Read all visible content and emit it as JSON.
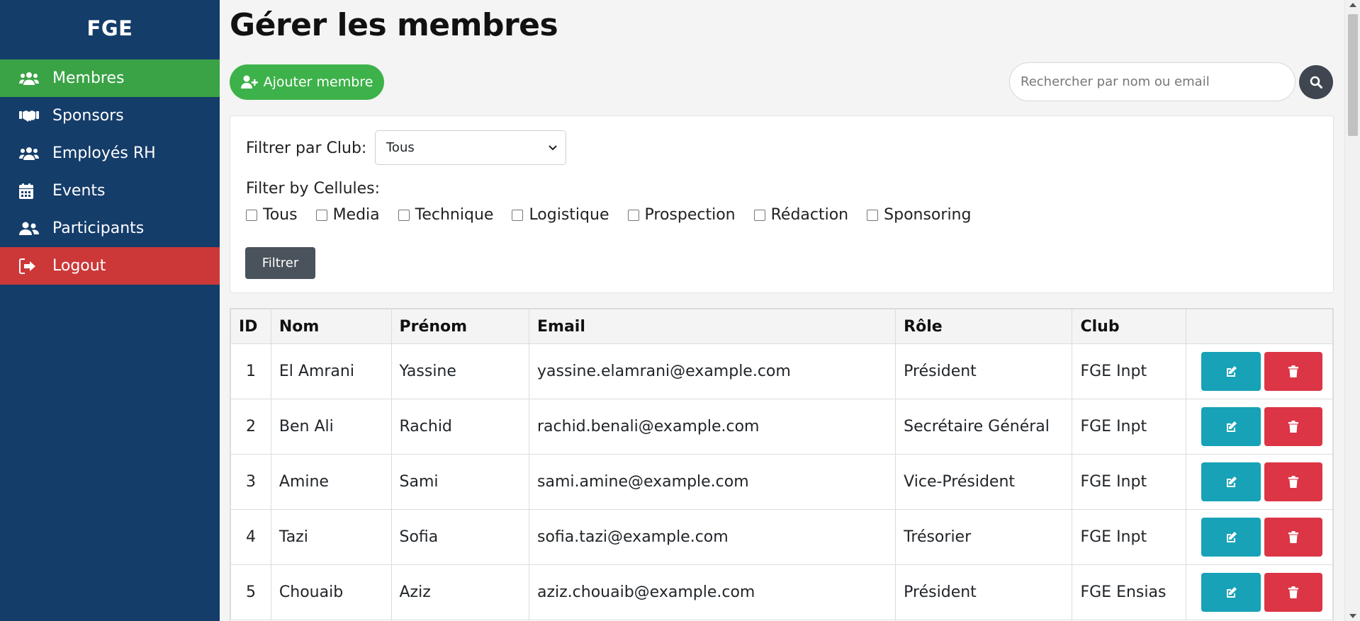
{
  "sidebar": {
    "brand": "FGE",
    "items": [
      {
        "label": "Membres",
        "icon": "users-icon",
        "active": true
      },
      {
        "label": "Sponsors",
        "icon": "handshake-icon"
      },
      {
        "label": "Employés RH",
        "icon": "users-icon"
      },
      {
        "label": "Events",
        "icon": "calendar-icon"
      },
      {
        "label": "Participants",
        "icon": "user-friends-icon"
      },
      {
        "label": "Logout",
        "icon": "sign-out-icon"
      }
    ]
  },
  "header": {
    "title": "Gérer les membres",
    "add_button": "Ajouter membre",
    "search_placeholder": "Rechercher par nom ou email"
  },
  "filters": {
    "club_label": "Filtrer par Club:",
    "club_selected": "Tous",
    "cellules_label": "Filter by Cellules:",
    "cellules": [
      "Tous",
      "Media",
      "Technique",
      "Logistique",
      "Prospection",
      "Rédaction",
      "Sponsoring"
    ],
    "filter_button": "Filtrer"
  },
  "table": {
    "headers": [
      "ID",
      "Nom",
      "Prénom",
      "Email",
      "Rôle",
      "Club",
      ""
    ],
    "rows": [
      {
        "id": "1",
        "nom": "El Amrani",
        "prenom": "Yassine",
        "email": "yassine.elamrani@example.com",
        "role": "Président",
        "club": "FGE Inpt"
      },
      {
        "id": "2",
        "nom": "Ben Ali",
        "prenom": "Rachid",
        "email": "rachid.benali@example.com",
        "role": "Secrétaire Général",
        "club": "FGE Inpt"
      },
      {
        "id": "3",
        "nom": "Amine",
        "prenom": "Sami",
        "email": "sami.amine@example.com",
        "role": "Vice-Président",
        "club": "FGE Inpt"
      },
      {
        "id": "4",
        "nom": "Tazi",
        "prenom": "Sofia",
        "email": "sofia.tazi@example.com",
        "role": "Trésorier",
        "club": "FGE Inpt"
      },
      {
        "id": "5",
        "nom": "Chouaib",
        "prenom": "Aziz",
        "email": "aziz.chouaib@example.com",
        "role": "Président",
        "club": "FGE Ensias"
      }
    ]
  },
  "colors": {
    "sidebar_bg": "#153d6a",
    "active_nav": "#3aa346",
    "logout": "#cc3838",
    "edit": "#17a2b8",
    "delete": "#dc3545"
  }
}
